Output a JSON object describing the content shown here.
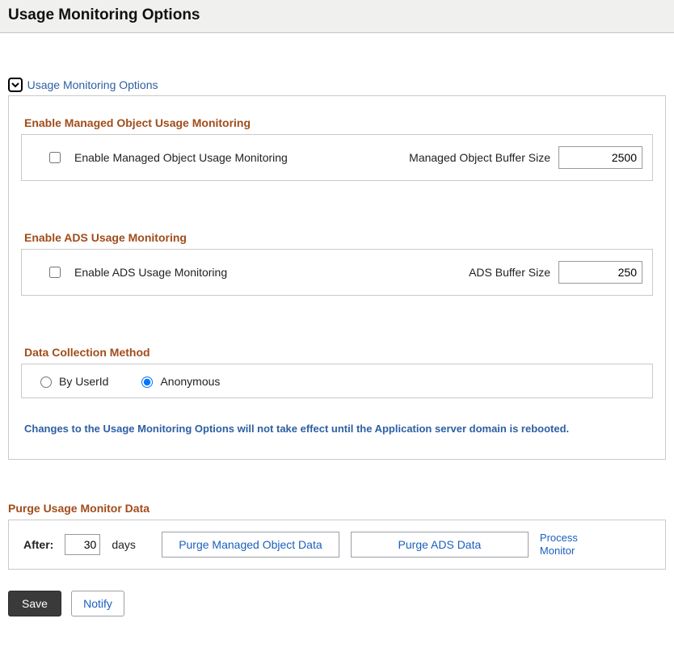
{
  "page_title": "Usage Monitoring Options",
  "section_label": "Usage Monitoring Options",
  "group1": {
    "title": "Enable Managed Object Usage Monitoring",
    "checkbox_label": "Enable Managed Object Usage Monitoring",
    "checked": false,
    "buffer_label": "Managed Object Buffer Size",
    "buffer_value": "2500"
  },
  "group2": {
    "title": "Enable ADS Usage Monitoring",
    "checkbox_label": "Enable ADS Usage Monitoring",
    "checked": false,
    "buffer_label": "ADS Buffer Size",
    "buffer_value": "250"
  },
  "group3": {
    "title": "Data Collection Method",
    "option1_label": "By UserId",
    "option2_label": "Anonymous",
    "selected": "Anonymous"
  },
  "warning": "Changes to the Usage Monitoring Options will not take effect until the Application server domain is rebooted.",
  "purge": {
    "title": "Purge Usage Monitor Data",
    "after_label": "After:",
    "days_value": "30",
    "days_label": "days",
    "btn1": "Purge Managed Object Data",
    "btn2": "Purge ADS Data",
    "process_monitor": "Process Monitor"
  },
  "footer": {
    "save": "Save",
    "notify": "Notify"
  }
}
